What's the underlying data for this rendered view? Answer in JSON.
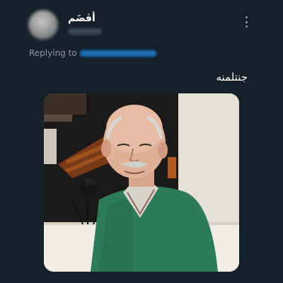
{
  "tweet": {
    "author": {
      "display_name": "أڤضَم"
    },
    "menu_icon": "more-vertical-icon",
    "reply_prefix": "Replying to",
    "text": "جنتلمنه",
    "media": {
      "alt": "photo"
    }
  }
}
